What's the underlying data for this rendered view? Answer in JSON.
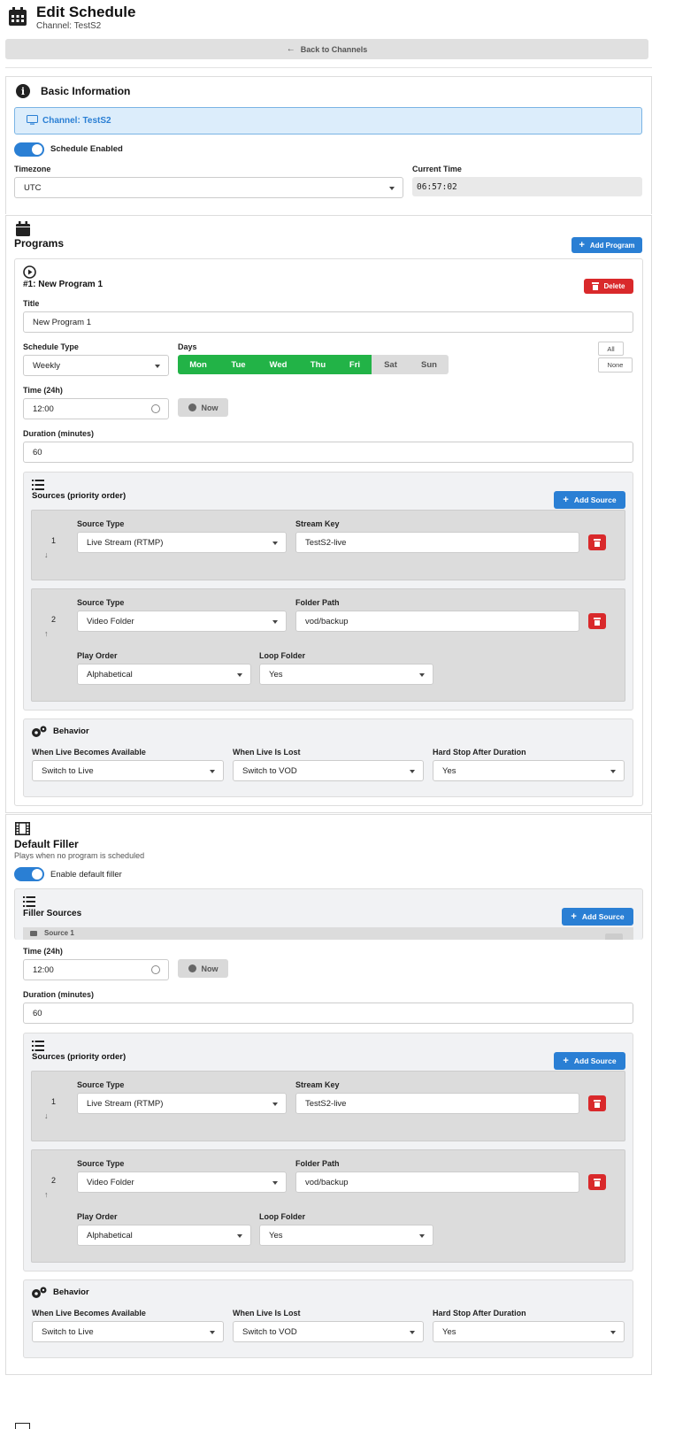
{
  "header": {
    "title": "Edit Schedule",
    "subtitle": "Channel: TestS2",
    "back_label": "Back to Channels"
  },
  "basic": {
    "title": "Basic Information",
    "channel_banner": "Channel: TestS2",
    "schedule_enabled_label": "Schedule Enabled",
    "timezone_label": "Timezone",
    "timezone_value": "UTC",
    "current_time_label": "Current Time",
    "current_time_value": "06:57:02"
  },
  "programs": {
    "title": "Programs",
    "add_program_label": "Add Program",
    "program": {
      "heading": "#1: New Program 1",
      "delete_label": "Delete",
      "title_label": "Title",
      "title_value": "New Program 1",
      "schedule_type_label": "Schedule Type",
      "schedule_type_value": "Weekly",
      "days_label": "Days",
      "days": [
        "Mon",
        "Tue",
        "Wed",
        "Thu",
        "Fri",
        "Sat",
        "Sun"
      ],
      "all_label": "All",
      "none_label": "None",
      "time_label": "Time (24h)",
      "time_value": "12:00",
      "now_label": "Now",
      "duration_label": "Duration (minutes)",
      "duration_value": "60"
    }
  },
  "sources_block": {
    "title": "Sources (priority order)",
    "add_source_label": "Add Source",
    "source1": {
      "num": "1",
      "type_label": "Source Type",
      "type_value": "Live Stream (RTMP)",
      "key_label": "Stream Key",
      "key_value": "TestS2-live"
    },
    "source2": {
      "num": "2",
      "type_label": "Source Type",
      "type_value": "Video Folder",
      "path_label": "Folder Path",
      "path_value": "vod/backup",
      "order_label": "Play Order",
      "order_value": "Alphabetical",
      "loop_label": "Loop Folder",
      "loop_value": "Yes"
    }
  },
  "behavior": {
    "title": "Behavior",
    "live_available_label": "When Live Becomes Available",
    "live_available_value": "Switch to Live",
    "live_lost_label": "When Live Is Lost",
    "live_lost_value": "Switch to VOD",
    "hard_stop_label": "Hard Stop After Duration",
    "hard_stop_value": "Yes"
  },
  "filler": {
    "title": "Default Filler",
    "subtitle": "Plays when no program is scheduled",
    "enable_label": "Enable default filler",
    "sources_title": "Filler Sources",
    "add_source_label": "Add Source",
    "source1_label": "Source 1"
  },
  "colors": {
    "accent": "#2a7fd4",
    "danger": "#d9292b",
    "success": "#22b347"
  }
}
